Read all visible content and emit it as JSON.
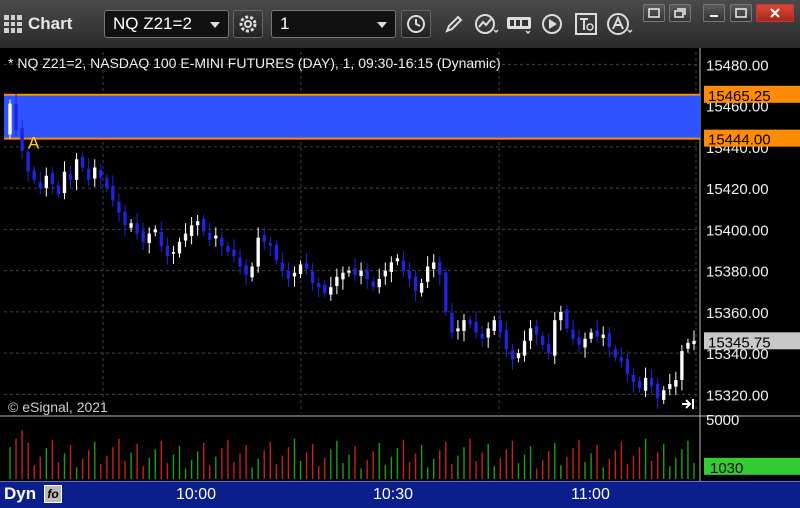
{
  "toolbar": {
    "app_label": "Chart",
    "symbol": "NQ Z21=2",
    "interval": "1"
  },
  "chart_header": "* NQ Z21=2, NASDAQ 100 E-MINI FUTURES (DAY), 1, 09:30-16:15 (Dynamic)",
  "copyright": "© eSignal, 2021",
  "bottom": {
    "mode": "Dyn",
    "time_labels": [
      "10:00",
      "10:30",
      "11:00"
    ]
  },
  "colors": {
    "bull": "#ffffff",
    "bear": "#1e24e0",
    "band": "#2f54ff",
    "orange": "#ff8c00",
    "current": "#c8c8c8",
    "vol_up": "#1aa01a",
    "vol_down": "#c82020",
    "vol_last": "#33cc33"
  },
  "chart_data": {
    "type": "candlestick",
    "y_ticks": [
      15480,
      15460,
      15440,
      15420,
      15400,
      15380,
      15360,
      15340,
      15320
    ],
    "y_tick_labels": [
      "15480.00",
      "15460.00",
      "15440.00",
      "15420.00",
      "15400.00",
      "15380.00",
      "15360.00",
      "15340.00",
      "15320.00"
    ],
    "ylim": [
      15311,
      15486
    ],
    "band": {
      "high": 15465.25,
      "low": 15444.0,
      "high_label": "15465.25",
      "low_label": "15444.00"
    },
    "current_price": {
      "value": 15345.75,
      "label": "15345.75"
    },
    "marker_label": "A",
    "volume_axis": {
      "max_label": "5000",
      "last_label": "1030",
      "max": 5000,
      "last": 1030
    },
    "closes": [
      15461,
      15448,
      15438,
      15428,
      15424,
      15420,
      15426,
      15422,
      15417,
      15428,
      15424,
      15434,
      15430,
      15424,
      15430,
      15425,
      15420,
      15414,
      15408,
      15402,
      15403,
      15398,
      15394,
      15398,
      15400,
      15392,
      15387,
      15389,
      15394,
      15398,
      15402,
      15404,
      15399,
      15395,
      15397,
      15392,
      15389,
      15387,
      15382,
      15378,
      15382,
      15396,
      15394,
      15392,
      15385,
      15380,
      15376,
      15379,
      15383,
      15381,
      15374,
      15372,
      15369,
      15372,
      15377,
      15379,
      15380,
      15378,
      15380,
      15376,
      15372,
      15376,
      15380,
      15384,
      15386,
      15380,
      15376,
      15370,
      15374,
      15382,
      15384,
      15378,
      15360,
      15350,
      15352,
      15356,
      15354,
      15350,
      15347,
      15352,
      15356,
      15350,
      15342,
      15337,
      15340,
      15346,
      15352,
      15349,
      15344,
      15340,
      15356,
      15360,
      15352,
      15347,
      15344,
      15347,
      15350,
      15348,
      15349,
      15343,
      15338,
      15336,
      15330,
      15326,
      15323,
      15328,
      15324,
      15318,
      15322,
      15325,
      15327,
      15341,
      15345,
      15346
    ]
  }
}
